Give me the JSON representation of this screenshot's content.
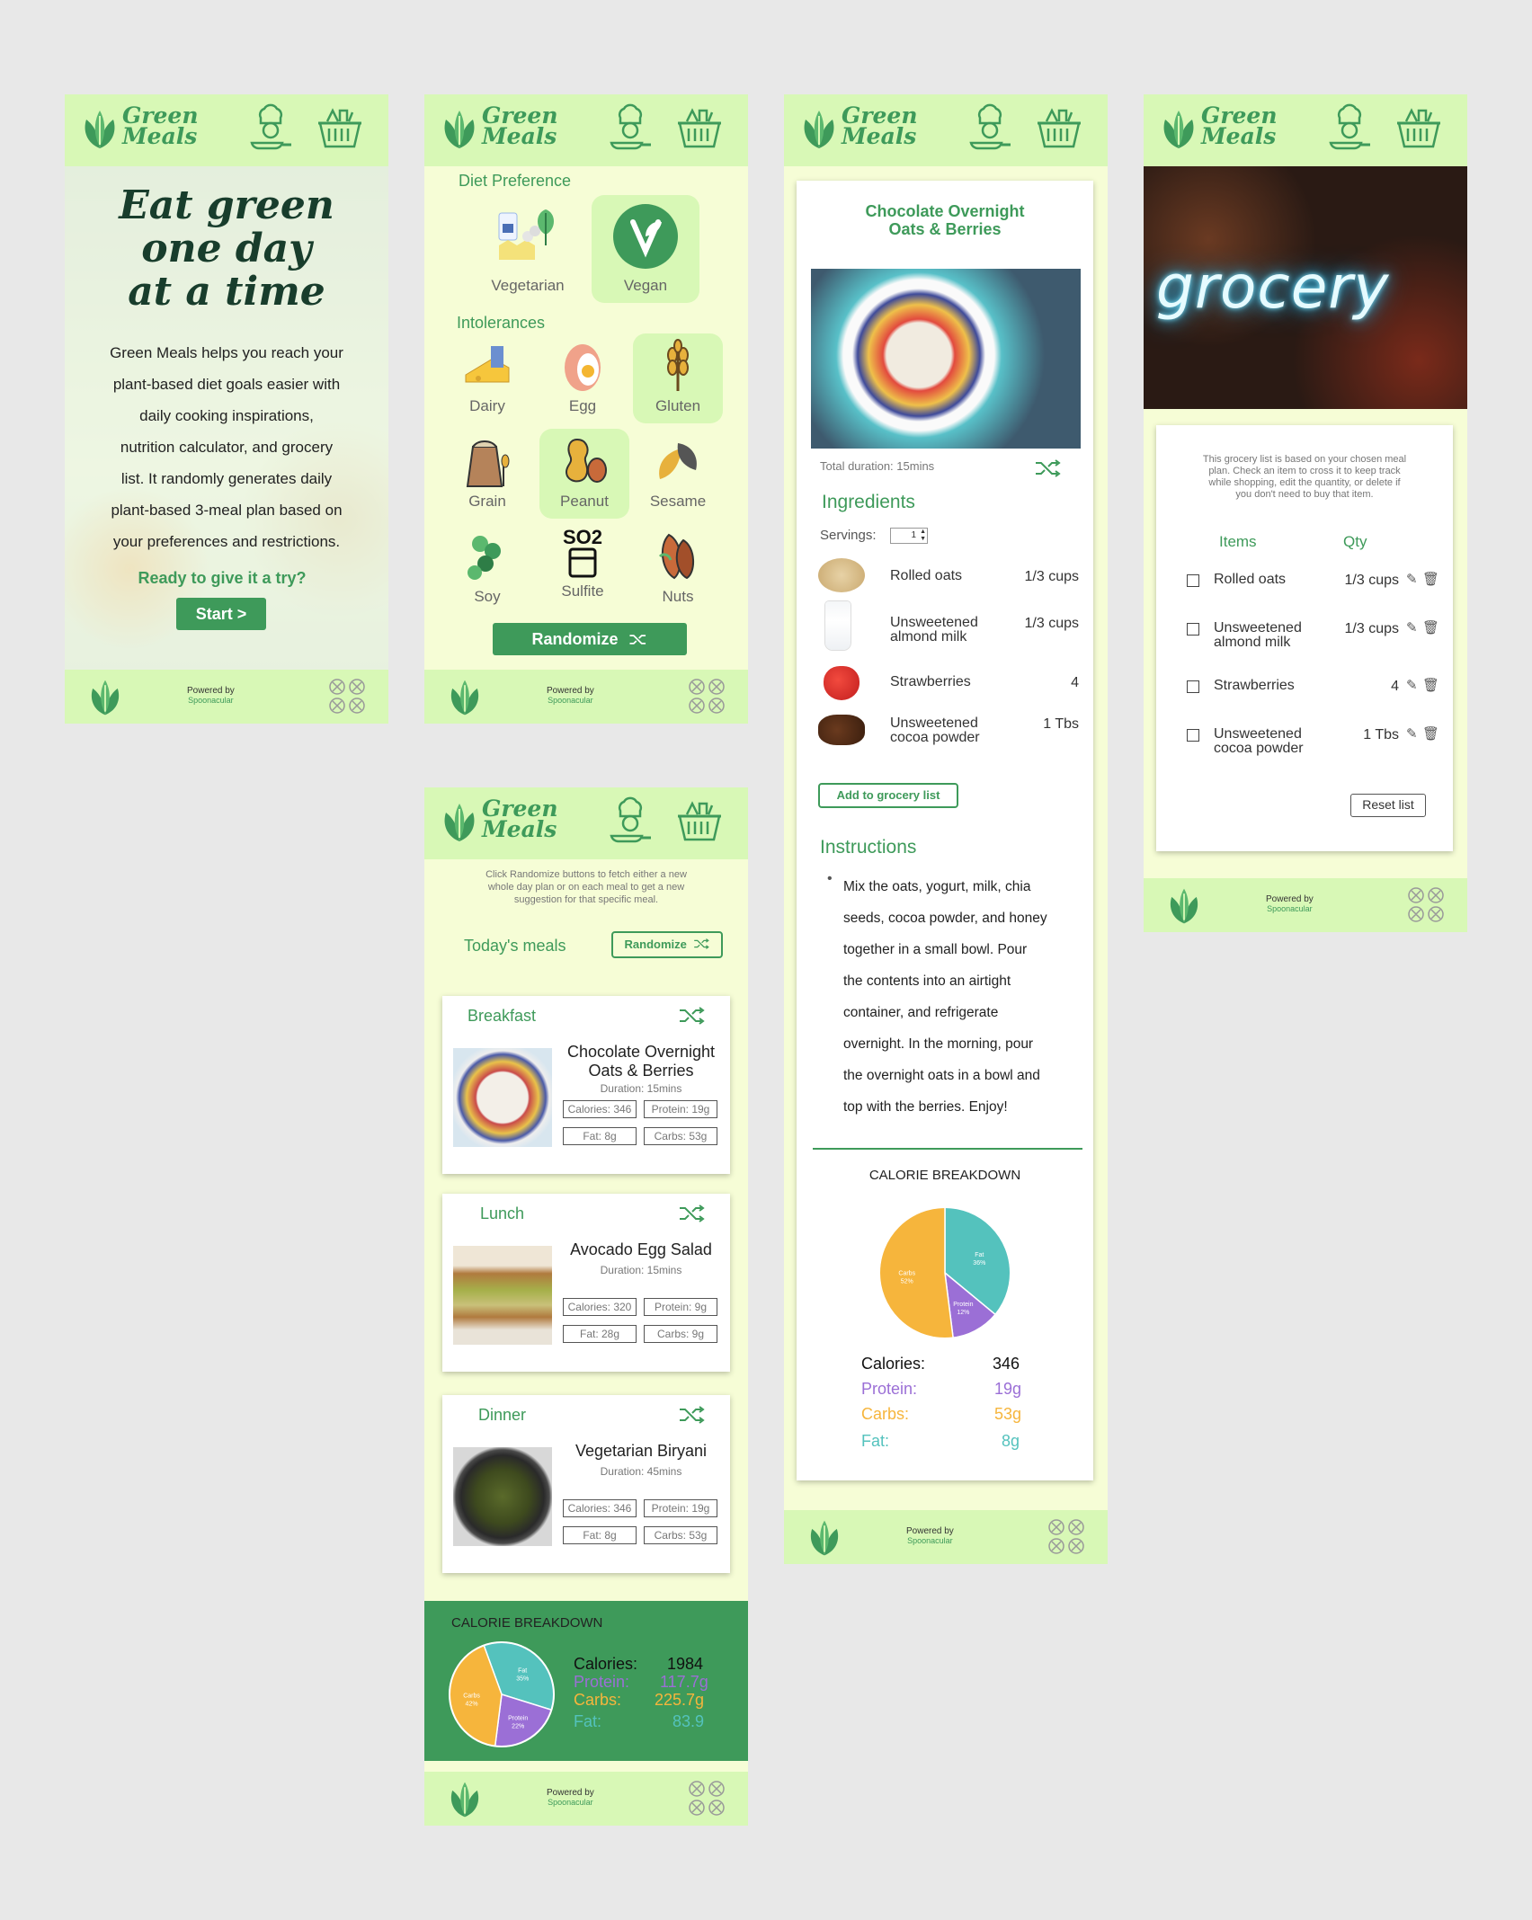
{
  "brand": {
    "name_line1": "Green",
    "name_line2": "Meals",
    "powered_by": "Powered by",
    "powered_brand": "Spoonacular"
  },
  "colors": {
    "brand_green": "#3e9a5a",
    "header_bg": "#d8f8b6",
    "screen_bg": "#f6fdd6",
    "protein": "#9b6fd6",
    "carbs": "#f6b53c",
    "fat": "#54c2bd"
  },
  "landing": {
    "headline_1": "Eat green",
    "headline_2": "one day",
    "headline_3": "at a time",
    "desc": [
      "Green Meals helps you reach your",
      "plant-based diet goals easier with",
      "daily cooking inspirations,",
      "nutrition calculator, and grocery",
      "list. It randomly generates daily",
      "plant-based 3-meal plan based on",
      "your preferences and restrictions."
    ],
    "cta_question": "Ready to give it a try?",
    "start_button": "Start  >"
  },
  "preferences": {
    "diet_title": "Diet Preference",
    "diets": [
      {
        "label": "Vegetarian",
        "selected": false
      },
      {
        "label": "Vegan",
        "selected": true
      }
    ],
    "intolerance_title": "Intolerances",
    "intolerances": [
      {
        "label": "Dairy",
        "selected": false
      },
      {
        "label": "Egg",
        "selected": false
      },
      {
        "label": "Gluten",
        "selected": true
      },
      {
        "label": "Grain",
        "selected": false
      },
      {
        "label": "Peanut",
        "selected": true
      },
      {
        "label": "Sesame",
        "selected": false
      },
      {
        "label": "Soy",
        "selected": false
      },
      {
        "label": "Sulfite",
        "selected": false
      },
      {
        "label": "Nuts",
        "selected": false
      }
    ],
    "sulfite_symbol": "SO2",
    "randomize_button": "Randomize"
  },
  "meals": {
    "hint": [
      "Click Randomize buttons to fetch either a new",
      "whole day plan or on each meal to get a new",
      "suggestion for that specific meal."
    ],
    "today_label": "Today's meals",
    "randomize_button": "Randomize",
    "items": [
      {
        "slot": "Breakfast",
        "name_1": "Chocolate Overnight",
        "name_2": "Oats & Berries",
        "duration": "Duration: 15mins",
        "calories": "Calories: 346",
        "protein": "Protein: 19g",
        "fat": "Fat: 8g",
        "carbs": "Carbs: 53g"
      },
      {
        "slot": "Lunch",
        "name_1": "Avocado Egg Salad",
        "name_2": "",
        "duration": "Duration: 15mins",
        "calories": "Calories: 320",
        "protein": "Protein: 9g",
        "fat": "Fat: 28g",
        "carbs": "Carbs: 9g"
      },
      {
        "slot": "Dinner",
        "name_1": "Vegetarian Biryani",
        "name_2": "",
        "duration": "Duration: 45mins",
        "calories": "Calories: 346",
        "protein": "Protein: 19g",
        "fat": "Fat: 8g",
        "carbs": "Carbs: 53g"
      }
    ],
    "breakdown_title": "CALORIE BREAKDOWN",
    "totals": [
      {
        "label": "Calories:",
        "value": "1984"
      },
      {
        "label": "Protein:",
        "value": "117.7g"
      },
      {
        "label": "Carbs:",
        "value": "225.7g"
      },
      {
        "label": "Fat:",
        "value": "83.9"
      }
    ]
  },
  "recipe": {
    "title_1": "Chocolate Overnight",
    "title_2": "Oats & Berries",
    "duration": "Total duration: 15mins",
    "ingredients_title": "Ingredients",
    "servings_label": "Servings:",
    "servings_value": "1",
    "ingredients": [
      {
        "name_1": "Rolled oats",
        "name_2": "",
        "qty": "1/3 cups"
      },
      {
        "name_1": "Unsweetened",
        "name_2": "almond milk",
        "qty": "1/3 cups"
      },
      {
        "name_1": "Strawberries",
        "name_2": "",
        "qty": "4"
      },
      {
        "name_1": "Unsweetened",
        "name_2": "cocoa powder",
        "qty": "1 Tbs"
      }
    ],
    "add_button": "Add to grocery list",
    "instructions_title": "Instructions",
    "instructions": [
      "Mix the oats, yogurt, milk, chia",
      "seeds, cocoa powder, and honey",
      "together in a small bowl. Pour",
      "the contents into an airtight",
      "container, and refrigerate",
      "overnight. In the morning, pour",
      "the overnight oats in a bowl and",
      "top with the berries. Enjoy!"
    ],
    "breakdown_title": "CALORIE BREAKDOWN",
    "nutrients": [
      {
        "label": "Calories:",
        "value": "346"
      },
      {
        "label": "Protein:",
        "value": "19g"
      },
      {
        "label": "Carbs:",
        "value": "53g"
      },
      {
        "label": "Fat:",
        "value": "8g"
      }
    ]
  },
  "grocery": {
    "hero_word": "grocery",
    "hint": [
      "This grocery list is based on your chosen meal",
      "plan. Check an item to cross it to keep track",
      "while shopping, edit the quantity, or delete if",
      "you don't need to buy that item."
    ],
    "col_items": "Items",
    "col_qty": "Qty",
    "items": [
      {
        "name_1": "Rolled oats",
        "name_2": "",
        "qty": "1/3 cups"
      },
      {
        "name_1": "Unsweetened",
        "name_2": "almond milk",
        "qty": "1/3 cups"
      },
      {
        "name_1": "Strawberries",
        "name_2": "",
        "qty": "4"
      },
      {
        "name_1": "Unsweetened",
        "name_2": "cocoa powder",
        "qty": "1 Tbs"
      }
    ],
    "reset_button": "Reset list"
  },
  "chart_data": [
    {
      "type": "pie",
      "title": "CALORIE BREAKDOWN",
      "categories": [
        "Fat",
        "Protein",
        "Carbs"
      ],
      "values": [
        35,
        22,
        42
      ],
      "labels": [
        "Fat 35%",
        "Protein 22%",
        "Carbs 42%"
      ]
    },
    {
      "type": "pie",
      "title": "CALORIE BREAKDOWN",
      "categories": [
        "Fat",
        "Protein",
        "Carbs"
      ],
      "values": [
        36,
        12,
        52
      ],
      "labels": [
        "Fat 36%",
        "Protein 12%",
        "Carbs 52%"
      ]
    }
  ]
}
